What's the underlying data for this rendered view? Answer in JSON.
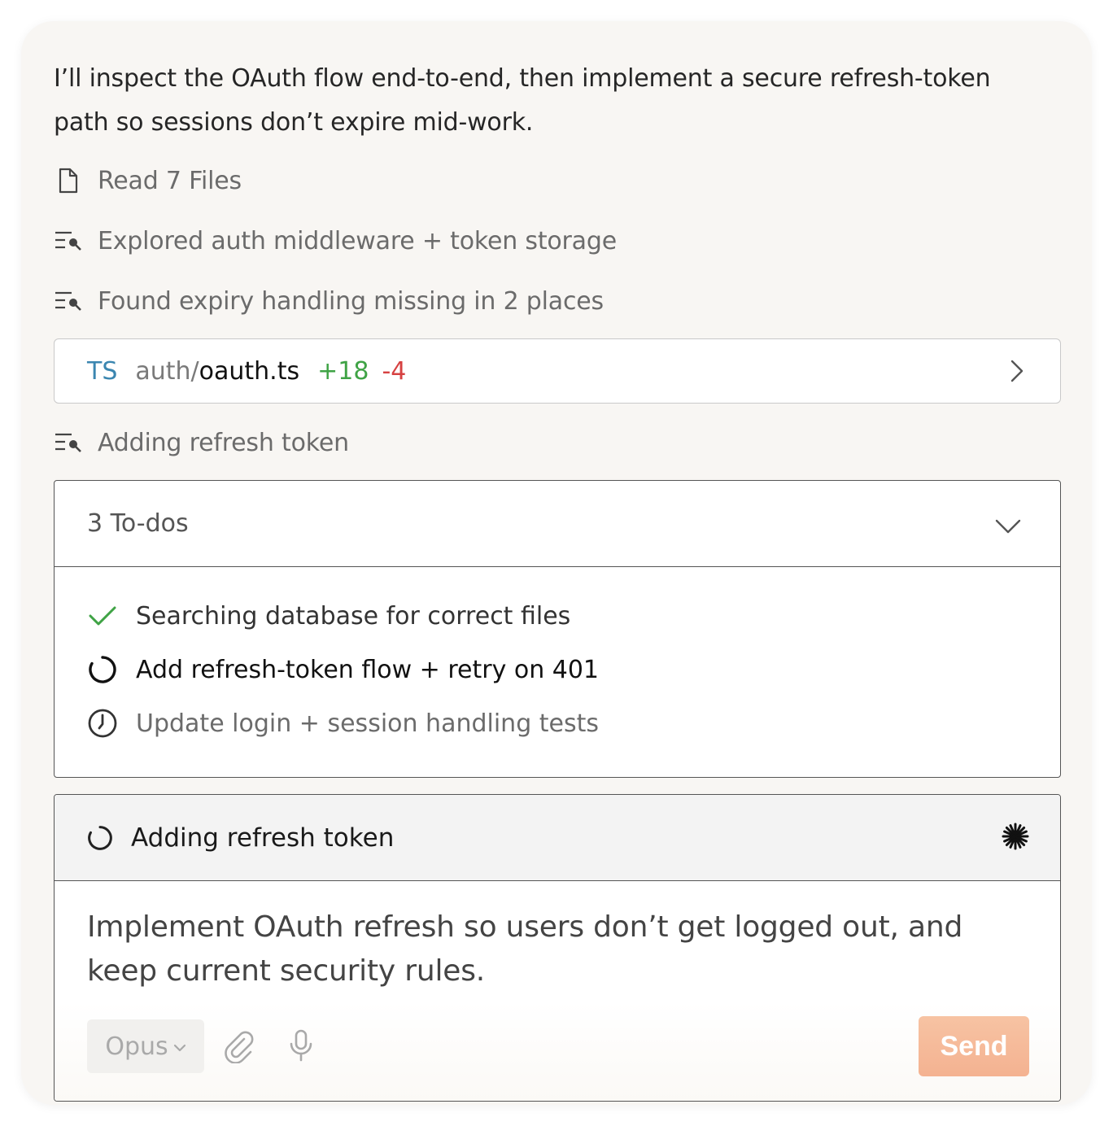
{
  "intro": "I’ll inspect the OAuth flow end-to-end, then implement a secure refresh-token path so sessions don’t expire mid-work.",
  "steps": [
    {
      "icon": "file-icon",
      "label": "Read 7 Files"
    },
    {
      "icon": "search-list-icon",
      "label": "Explored auth middleware + token storage"
    },
    {
      "icon": "search-list-icon",
      "label": "Found expiry handling missing in 2 places"
    },
    {
      "icon": "search-list-icon",
      "label": "Adding refresh token"
    }
  ],
  "file_change": {
    "lang": "TS",
    "dir": "auth/",
    "name": "oauth.ts",
    "additions": "+18",
    "deletions": "-4"
  },
  "todos": {
    "title": "3 To-dos",
    "items": [
      {
        "status": "done",
        "icon": "check-icon",
        "label": "Searching database for correct files"
      },
      {
        "status": "in-progress",
        "icon": "spinner-icon",
        "label": "Add refresh-token flow + retry on 401"
      },
      {
        "status": "pending",
        "icon": "clock-icon",
        "label": "Update login + session handling tests"
      }
    ]
  },
  "composer": {
    "status_label": "Adding refresh token",
    "prompt_text": "Implement OAuth refresh so users don’t get logged out, and keep current security rules.",
    "model": "Opus",
    "send_label": "Send"
  },
  "colors": {
    "accent_send": "#f4b291",
    "additions": "#3fa345",
    "deletions": "#d64141",
    "lang_badge": "#3b86b0",
    "check": "#3fa345"
  }
}
